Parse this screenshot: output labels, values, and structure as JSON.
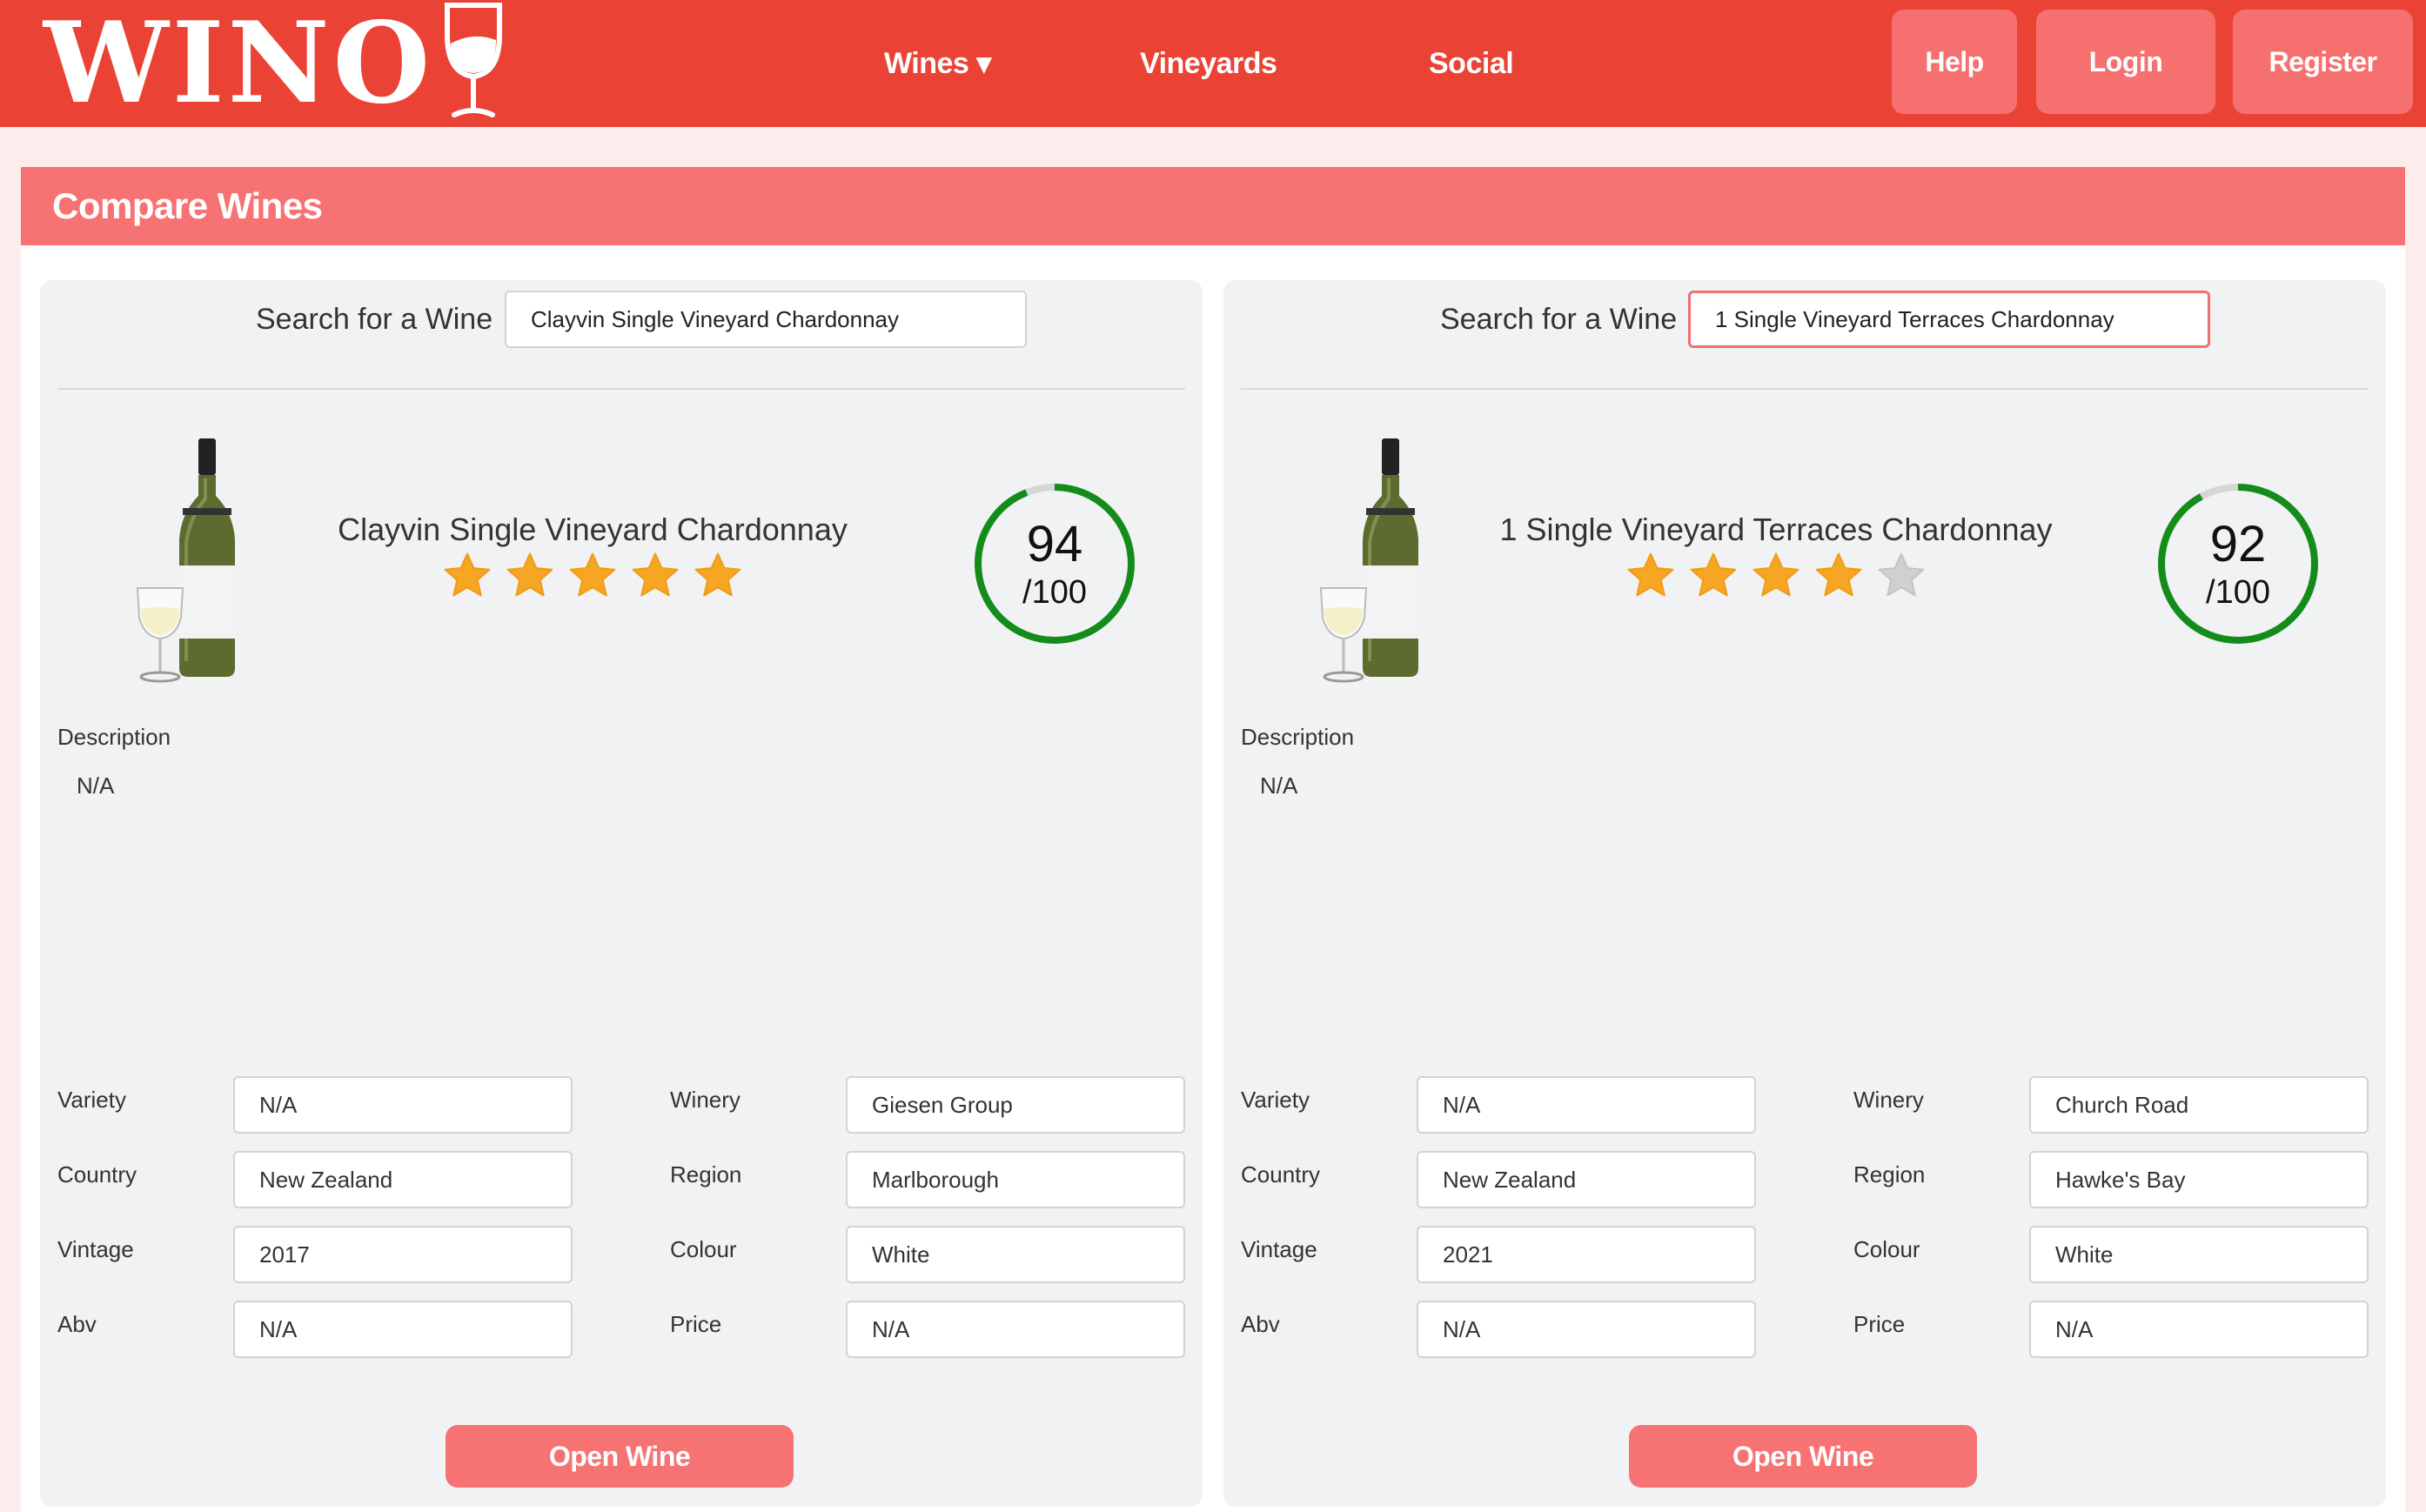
{
  "brand": {
    "name": "WINO"
  },
  "nav": {
    "wines": "Wines ▾",
    "vineyards": "Vineyards",
    "social": "Social"
  },
  "buttons": {
    "help": "Help",
    "login": "Login",
    "register": "Register"
  },
  "page_title": "Compare Wines",
  "colors": {
    "brand_red": "#ea4336",
    "accent": "#f77373",
    "score_ring": "#138c1a",
    "star": "#f6a623"
  },
  "left": {
    "search_label": "Search for a Wine",
    "search_value": "Clayvin Single Vineyard Chardonnay",
    "wine_name": "Clayvin Single Vineyard Chardonnay",
    "rating_stars": 5,
    "score": "94",
    "score_out_of": "/100",
    "description_label": "Description",
    "description": "N/A",
    "fields": {
      "variety_label": "Variety",
      "variety": "N/A",
      "winery_label": "Winery",
      "winery": "Giesen Group",
      "country_label": "Country",
      "country": "New Zealand",
      "region_label": "Region",
      "region": "Marlborough",
      "vintage_label": "Vintage",
      "vintage": "2017",
      "colour_label": "Colour",
      "colour": "White",
      "abv_label": "Abv",
      "abv": "N/A",
      "price_label": "Price",
      "price": "N/A"
    },
    "open_button": "Open Wine"
  },
  "right": {
    "search_label": "Search for a Wine",
    "search_value": "1 Single Vineyard Terraces Chardonnay",
    "wine_name": "1 Single Vineyard Terraces Chardonnay",
    "rating_stars": 4,
    "score": "92",
    "score_out_of": "/100",
    "description_label": "Description",
    "description": "N/A",
    "fields": {
      "variety_label": "Variety",
      "variety": "N/A",
      "winery_label": "Winery",
      "winery": "Church Road",
      "country_label": "Country",
      "country": "New Zealand",
      "region_label": "Region",
      "region": "Hawke's Bay",
      "vintage_label": "Vintage",
      "vintage": "2021",
      "colour_label": "Colour",
      "colour": "White",
      "abv_label": "Abv",
      "abv": "N/A",
      "price_label": "Price",
      "price": "N/A"
    },
    "open_button": "Open Wine"
  }
}
